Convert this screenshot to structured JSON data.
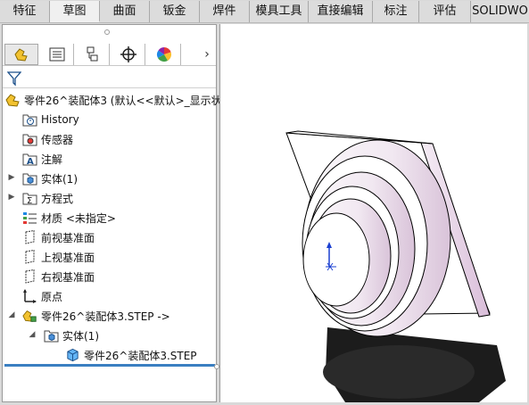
{
  "tabs": [
    {
      "label": "特征",
      "active": false
    },
    {
      "label": "草图",
      "active": true
    },
    {
      "label": "曲面",
      "active": false
    },
    {
      "label": "钣金",
      "active": false
    },
    {
      "label": "焊件",
      "active": false
    },
    {
      "label": "模具工具",
      "active": false
    },
    {
      "label": "直接编辑",
      "active": false
    },
    {
      "label": "标注",
      "active": false
    },
    {
      "label": "评估",
      "active": false
    },
    {
      "label": "SOLIDWO",
      "active": false
    }
  ],
  "panel": {
    "toolbar_icons": [
      "feature-manager-icon",
      "property-manager-icon",
      "configuration-manager-icon",
      "dimxpert-icon",
      "display-manager-icon"
    ],
    "more_arrow": "›"
  },
  "tree": {
    "root": "零件26^装配体3  (默认<<默认>_显示状",
    "items": [
      {
        "label": "History",
        "icon": "history-icon"
      },
      {
        "label": "传感器",
        "icon": "sensor-icon"
      },
      {
        "label": "注解",
        "icon": "annotation-icon"
      },
      {
        "label": "实体(1)",
        "icon": "solid-body-icon"
      },
      {
        "label": "方程式",
        "icon": "equation-icon"
      },
      {
        "label": "材质 <未指定>",
        "icon": "material-icon"
      },
      {
        "label": "前视基准面",
        "icon": "plane-icon"
      },
      {
        "label": "上视基准面",
        "icon": "plane-icon"
      },
      {
        "label": "右视基准面",
        "icon": "plane-icon"
      },
      {
        "label": "原点",
        "icon": "origin-icon"
      }
    ],
    "sub_part": "零件26^装配体3.STEP ->",
    "sub_body": "实体(1)",
    "sub_body_item": "零件26^装配体3.STEP"
  },
  "colors": {
    "accent": "#3a7fc1",
    "tab_bg": "#d9d9d9",
    "part_face": "#f4f0f4",
    "part_edge": "#e0c8e0"
  }
}
